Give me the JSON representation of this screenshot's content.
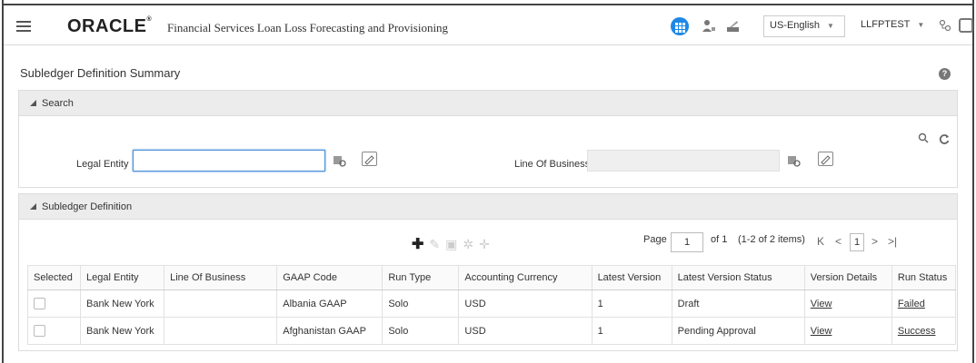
{
  "header": {
    "logo": "ORACLE",
    "app_title": "Financial Services Loan Loss Forecasting and Provisioning",
    "language": "US-English",
    "user": "LLFPTEST"
  },
  "page": {
    "title": "Subledger Definition Summary"
  },
  "search": {
    "section_label": "Search",
    "legal_entity_label": "Legal Entity",
    "legal_entity_value": "",
    "line_of_business_label": "Line Of Business",
    "line_of_business_value": ""
  },
  "grid": {
    "section_label": "Subledger Definition",
    "pager": {
      "page_label": "Page",
      "page_value": "1",
      "of_label": "of 1",
      "items_label": "(1-2 of 2 items)",
      "current_page": "1"
    },
    "columns": [
      "Selected",
      "Legal Entity",
      "Line Of Business",
      "GAAP Code",
      "Run Type",
      "Accounting Currency",
      "Latest Version",
      "Latest Version Status",
      "Version Details",
      "Run Status"
    ],
    "rows": [
      {
        "legal_entity": "Bank New York",
        "line_of_business": "",
        "gaap_code": "Albania GAAP",
        "run_type": "Solo",
        "currency": "USD",
        "latest_version": "1",
        "status": "Draft",
        "details": "View",
        "run_status": "Failed"
      },
      {
        "legal_entity": "Bank New York",
        "line_of_business": "",
        "gaap_code": "Afghanistan GAAP",
        "run_type": "Solo",
        "currency": "USD",
        "latest_version": "1",
        "status": "Pending Approval",
        "details": "View",
        "run_status": "Success"
      }
    ]
  }
}
